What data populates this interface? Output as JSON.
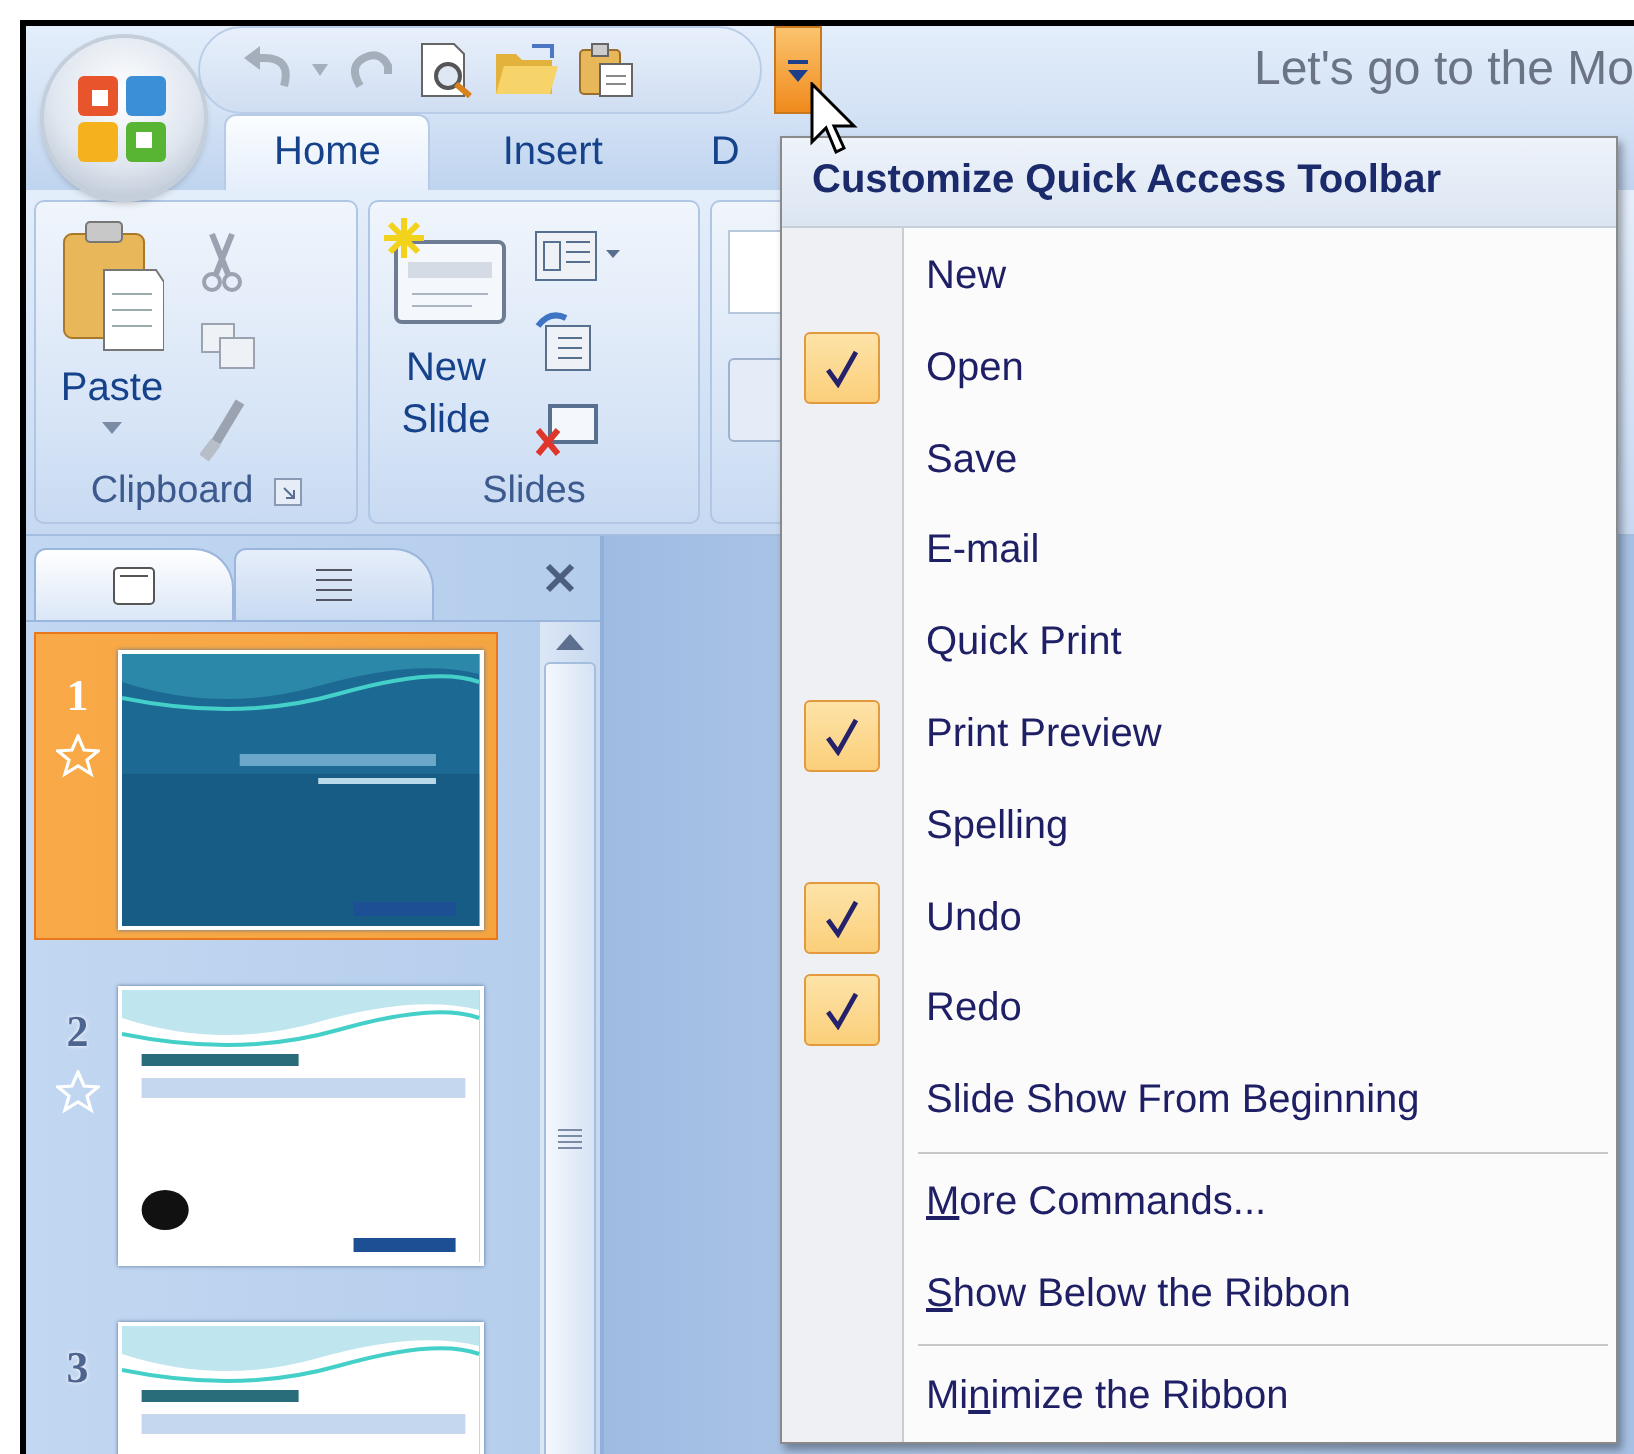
{
  "window": {
    "title": "Let's go to the Mo"
  },
  "quick_access_toolbar": {
    "undo_enabled": false,
    "redo_enabled": false
  },
  "tabs": [
    {
      "label": "Home",
      "selected": true
    },
    {
      "label": "Insert",
      "selected": false
    },
    {
      "label": "D",
      "selected": false
    }
  ],
  "ribbon": {
    "groups": [
      {
        "kind": "clipboard",
        "label": "Clipboard",
        "big_button": "Paste"
      },
      {
        "kind": "slides",
        "label": "Slides",
        "big_button": "New Slide"
      },
      {
        "kind": "partial"
      }
    ]
  },
  "slides_pane": {
    "slides": [
      {
        "number": "1",
        "selected": true,
        "animated": true
      },
      {
        "number": "2",
        "selected": false,
        "animated": true
      },
      {
        "number": "3",
        "selected": false,
        "animated": false
      }
    ]
  },
  "menu": {
    "title": "Customize Quick Access Toolbar",
    "sections": [
      [
        {
          "label": "New",
          "checked": false
        },
        {
          "label": "Open",
          "checked": true
        },
        {
          "label": "Save",
          "checked": false
        },
        {
          "label": "E-mail",
          "checked": false
        },
        {
          "label": "Quick Print",
          "checked": false
        },
        {
          "label": "Print Preview",
          "checked": true
        },
        {
          "label": "Spelling",
          "checked": false
        },
        {
          "label": "Undo",
          "checked": true
        },
        {
          "label": "Redo",
          "checked": true
        },
        {
          "label": "Slide Show From Beginning",
          "checked": false
        }
      ],
      [
        {
          "key": "M",
          "rest": "ore Commands..."
        },
        {
          "key": "S",
          "rest": "how Below the Ribbon"
        }
      ],
      [
        {
          "before": "Mi",
          "key": "n",
          "rest": "imize the Ribbon"
        }
      ]
    ]
  }
}
